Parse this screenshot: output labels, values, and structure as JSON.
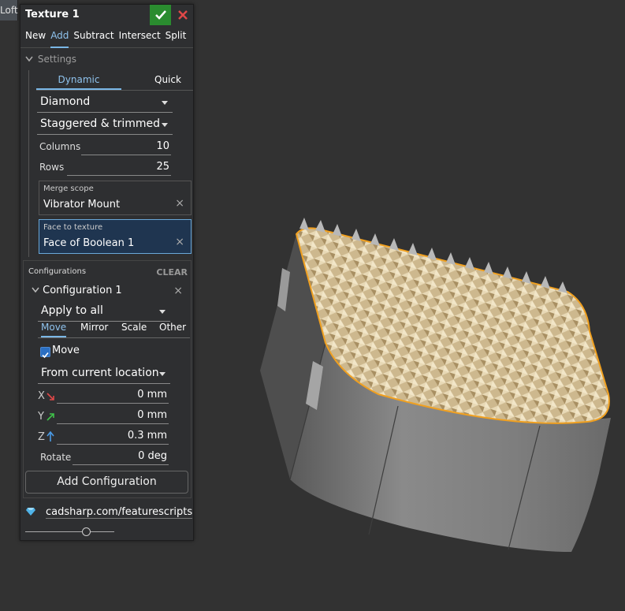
{
  "toolbar": {
    "loft_tab": "Loft"
  },
  "panel": {
    "title": "Texture 1",
    "op_tabs": [
      {
        "label": "New"
      },
      {
        "label": "Add",
        "active": true
      },
      {
        "label": "Subtract"
      },
      {
        "label": "Intersect"
      },
      {
        "label": "Split"
      }
    ],
    "settings_label": "Settings",
    "subtabs": {
      "dynamic": "Dynamic",
      "quick": "Quick"
    },
    "pattern_dropdown": "Diamond",
    "layout_dropdown": "Staggered & trimmed",
    "columns": {
      "label": "Columns",
      "value": "10"
    },
    "rows": {
      "label": "Rows",
      "value": "25"
    },
    "merge_scope": {
      "label": "Merge scope",
      "value": "Vibrator Mount"
    },
    "face_to_texture": {
      "label": "Face to texture",
      "value": "Face of Boolean 1"
    },
    "configurations": {
      "header": "Configurations",
      "clear": "CLEAR",
      "item_title": "Configuration 1",
      "apply_dropdown": "Apply to all",
      "tabs": [
        "Move",
        "Mirror",
        "Scale",
        "Other"
      ],
      "move_checkbox_label": "Move",
      "move_checked": true,
      "location_dropdown": "From current location",
      "x": {
        "label": "X",
        "value": "0 mm"
      },
      "y": {
        "label": "Y",
        "value": "0 mm"
      },
      "z": {
        "label": "Z",
        "value": "0.3 mm"
      },
      "rotate": {
        "label": "Rotate",
        "value": "0 deg"
      },
      "add_button": "Add Configuration"
    },
    "footer_link": "cadsharp.com/featurescripts"
  },
  "colors": {
    "accent": "#7ab7e6",
    "ok": "#2a8c2f",
    "cancel": "#e04848",
    "highlight_edge": "#f0a020",
    "texture": "#d9c7a0",
    "body_gray": "#7a7a7a"
  }
}
